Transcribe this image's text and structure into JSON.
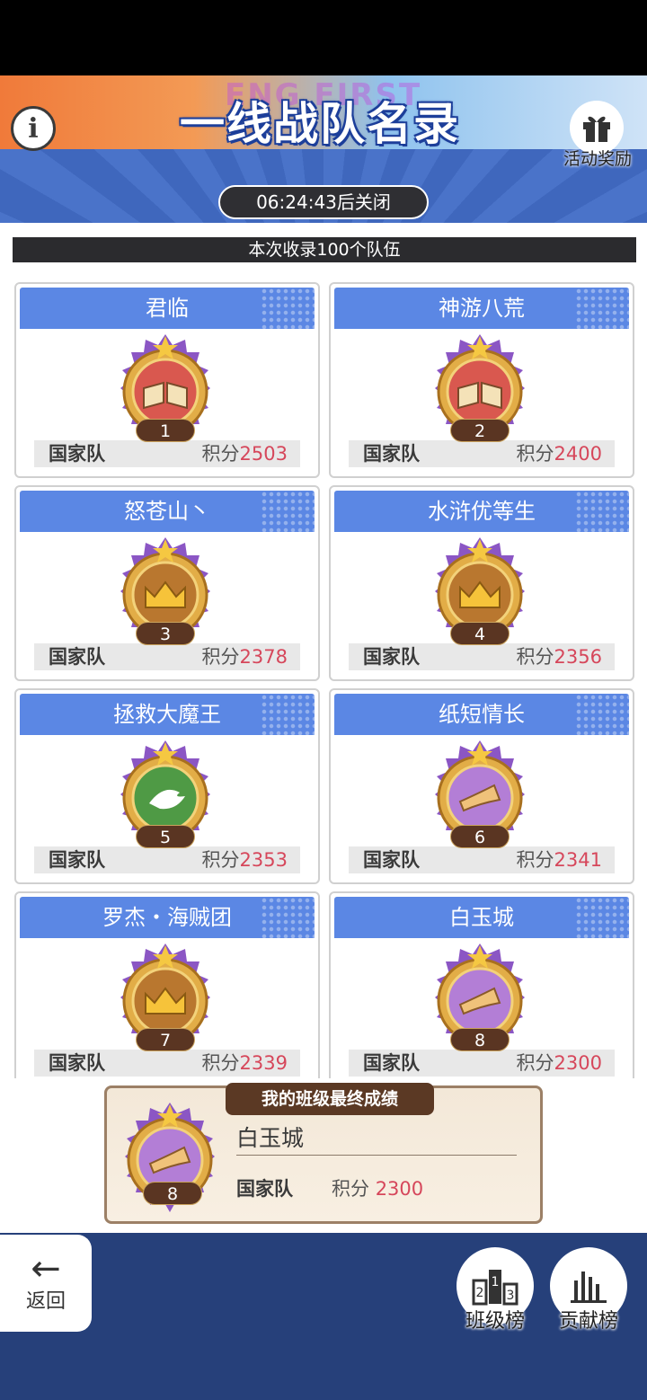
{
  "header": {
    "subtitle": "ENG FIRST",
    "title": "一线战队名录",
    "gift_label": "活动奖励",
    "timer": "06:24:43后关闭"
  },
  "summary": "本次收录100个队伍",
  "teams": [
    {
      "name": "君临",
      "rank": "1",
      "type": "国家队",
      "score_label": "积分",
      "score": "2503",
      "emblem": "book-emblem-icon"
    },
    {
      "name": "神游八荒",
      "rank": "2",
      "type": "国家队",
      "score_label": "积分",
      "score": "2400",
      "emblem": "book-emblem-icon"
    },
    {
      "name": "怒苍山丶",
      "rank": "3",
      "type": "国家队",
      "score_label": "积分",
      "score": "2378",
      "emblem": "crown-emblem-icon"
    },
    {
      "name": "水浒优等生",
      "rank": "4",
      "type": "国家队",
      "score_label": "积分",
      "score": "2356",
      "emblem": "crown-emblem-icon"
    },
    {
      "name": "拯救大魔王",
      "rank": "5",
      "type": "国家队",
      "score_label": "积分",
      "score": "2353",
      "emblem": "dove-emblem-icon"
    },
    {
      "name": "纸短情长",
      "rank": "6",
      "type": "国家队",
      "score_label": "积分",
      "score": "2341",
      "emblem": "horn-emblem-icon"
    },
    {
      "name": "罗杰・海贼团",
      "rank": "7",
      "type": "国家队",
      "score_label": "积分",
      "score": "2339",
      "emblem": "crown-emblem-icon"
    },
    {
      "name": "白玉城",
      "rank": "8",
      "type": "国家队",
      "score_label": "积分",
      "score": "2300",
      "emblem": "horn-emblem-icon"
    }
  ],
  "my_result": {
    "title": "我的班级最终成绩",
    "name": "白玉城",
    "rank": "8",
    "type": "国家队",
    "score_label": "积分",
    "score": "2300"
  },
  "nav": {
    "back_label": "返回",
    "class_rank_label": "班级榜",
    "contribution_label": "贡献榜"
  },
  "colors": {
    "card_header": "#5b87e4",
    "score": "#d6475b",
    "bottom_bar": "#26407a"
  }
}
